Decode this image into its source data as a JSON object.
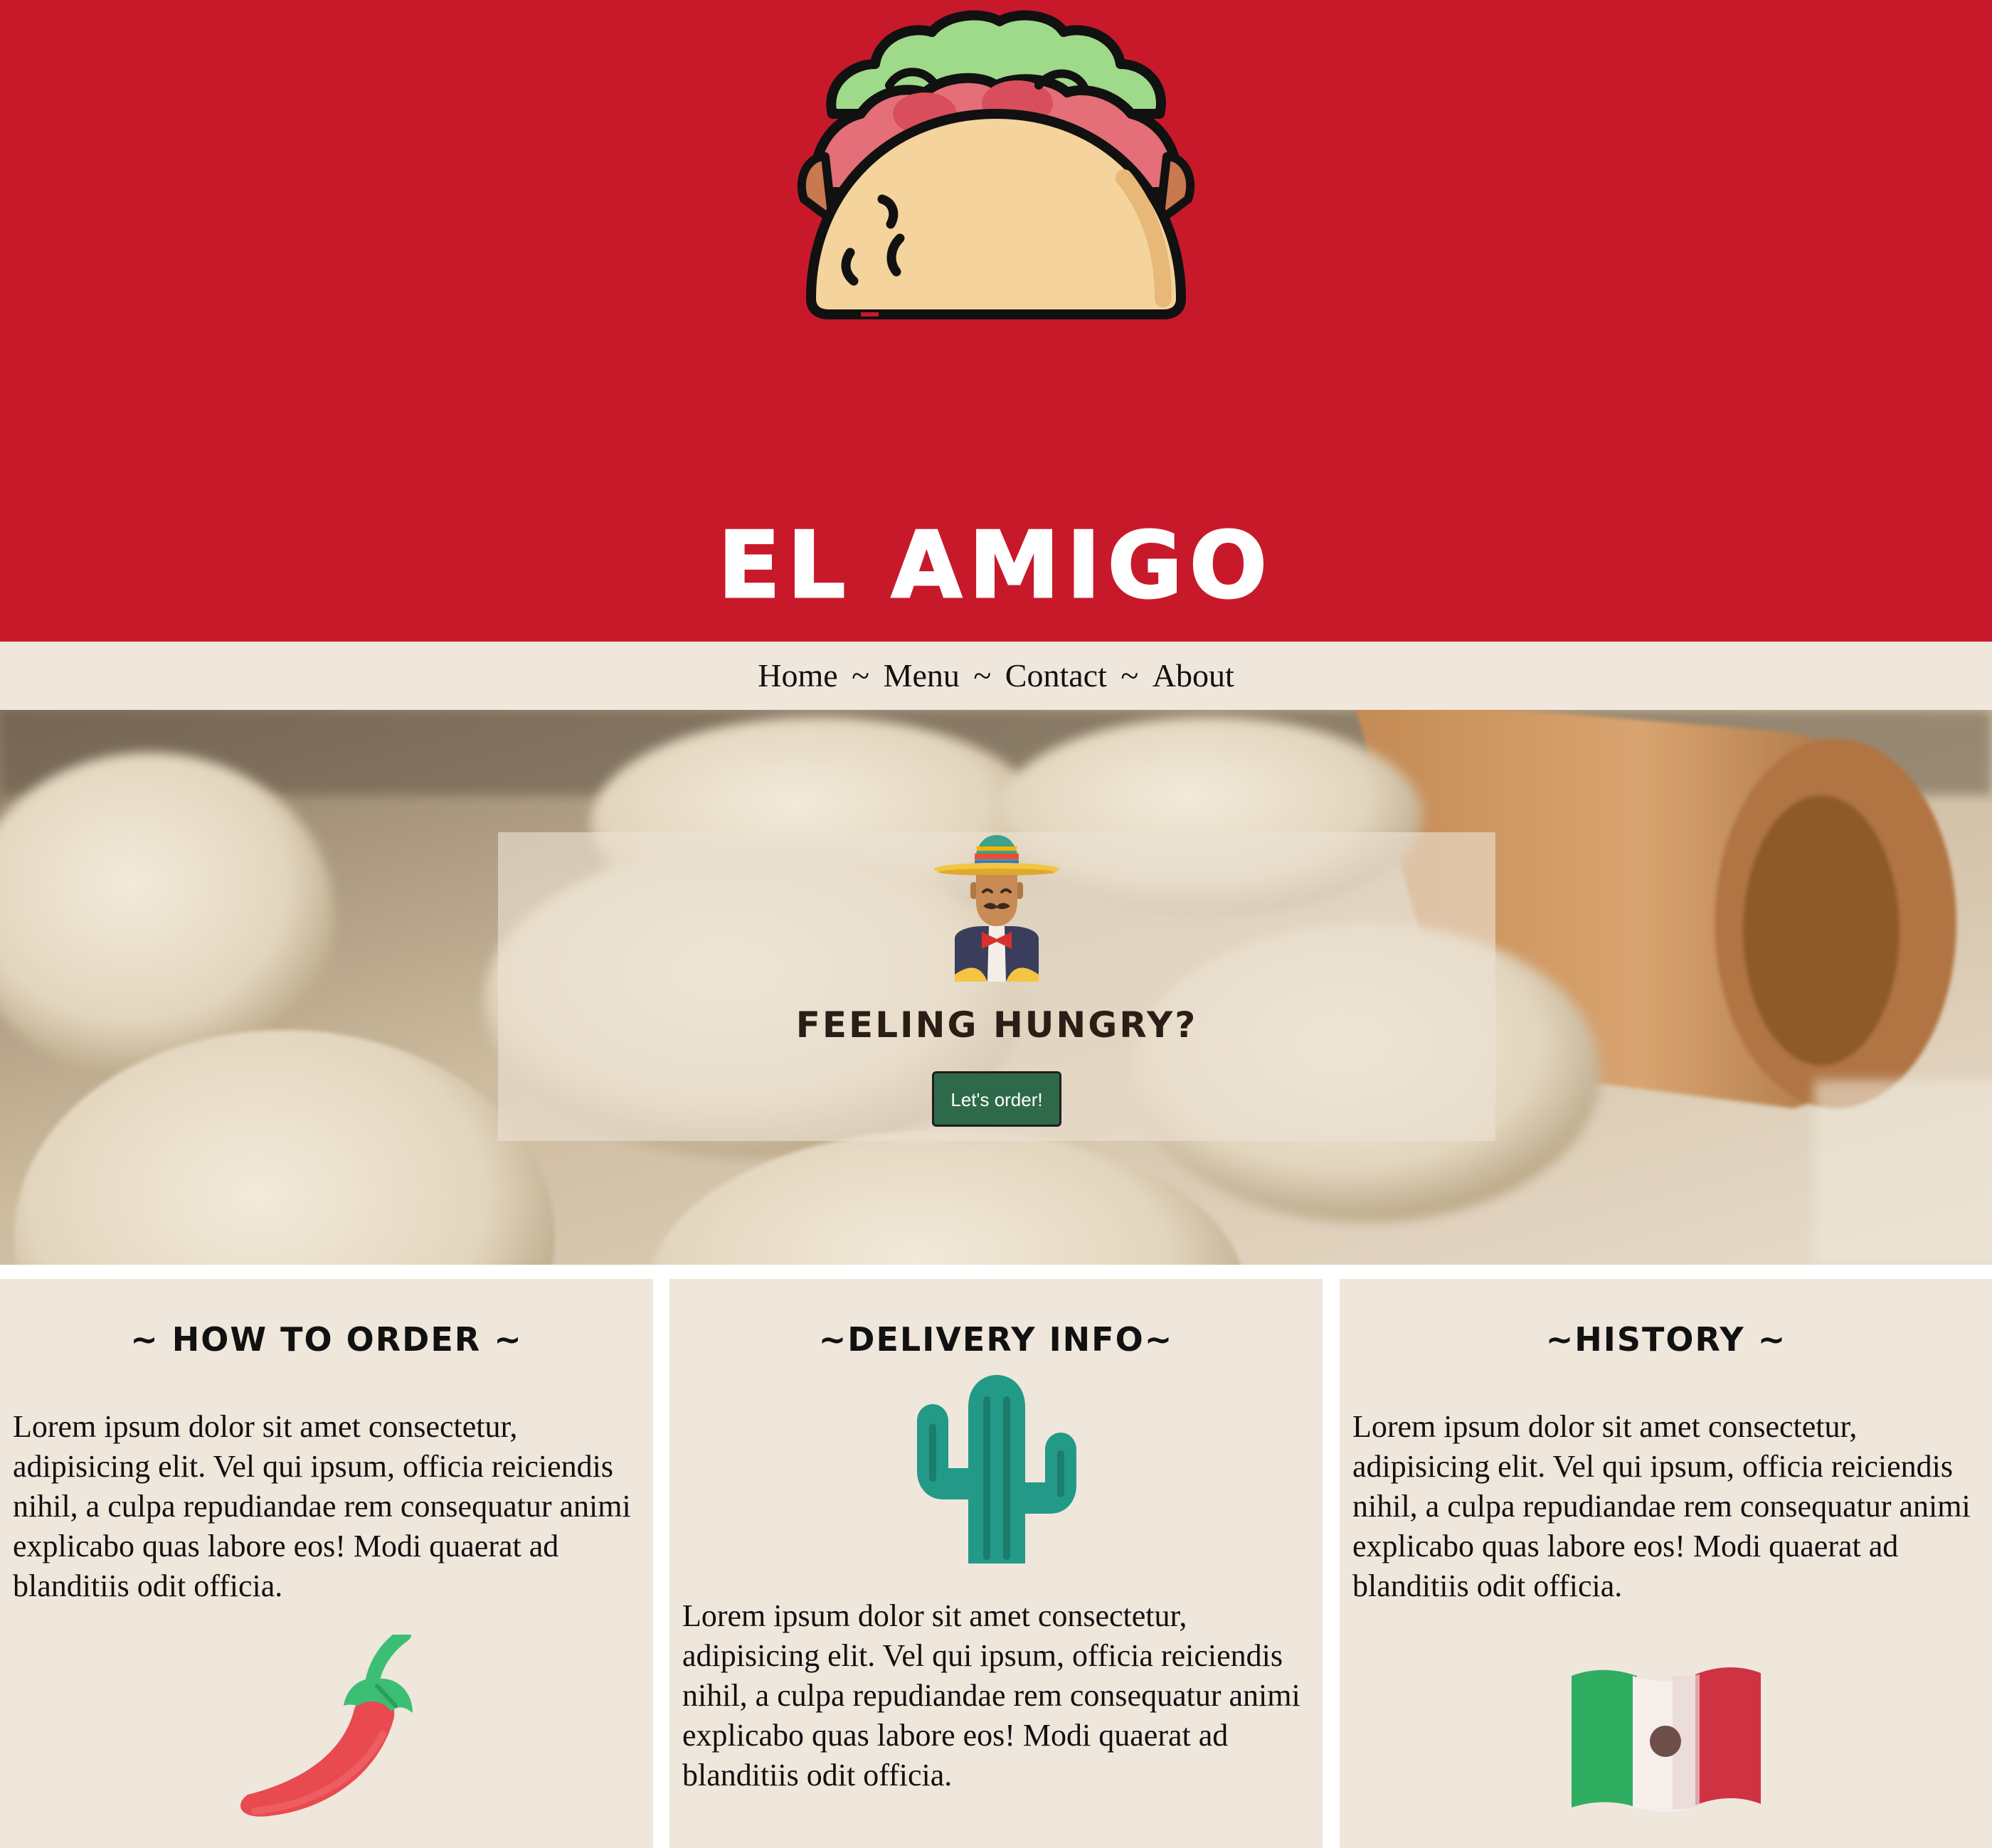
{
  "header": {
    "logo": "taco-icon",
    "title": "EL AMIGO",
    "background_color": "#c8192b"
  },
  "nav": {
    "items": [
      "Home",
      "Menu",
      "Contact",
      "About"
    ],
    "separator": "~"
  },
  "hero": {
    "background": "dough-balls-and-rolling-pin-photo",
    "icon": "mariachi-icon",
    "title": "FEELING HUNGRY?",
    "button_label": "Let's order!",
    "button_color": "#2e6a4a"
  },
  "columns": [
    {
      "heading": "~ HOW TO ORDER ~",
      "text": "Lorem ipsum dolor sit amet consectetur, adipisicing elit. Vel qui ipsum, officia reiciendis nihil, a culpa repudiandae rem consequatur animi explicabo quas labore eos! Modi quaerat ad blanditiis odit officia.",
      "icon": "chili-pepper-icon"
    },
    {
      "heading": "~DELIVERY INFO~",
      "text": "Lorem ipsum dolor sit amet consectetur, adipisicing elit. Vel qui ipsum, officia reiciendis nihil, a culpa repudiandae rem consequatur animi explicabo quas labore eos! Modi quaerat ad blanditiis odit officia.",
      "icon": "cactus-icon"
    },
    {
      "heading": "~HISTORY ~",
      "text": "Lorem ipsum dolor sit amet consectetur, adipisicing elit. Vel qui ipsum, officia reiciendis nihil, a culpa repudiandae rem consequatur animi explicabo quas labore eos! Modi quaerat ad blanditiis odit officia.",
      "icon": "mexican-flag-icon"
    }
  ],
  "colors": {
    "panel_background": "#efe6dc"
  }
}
